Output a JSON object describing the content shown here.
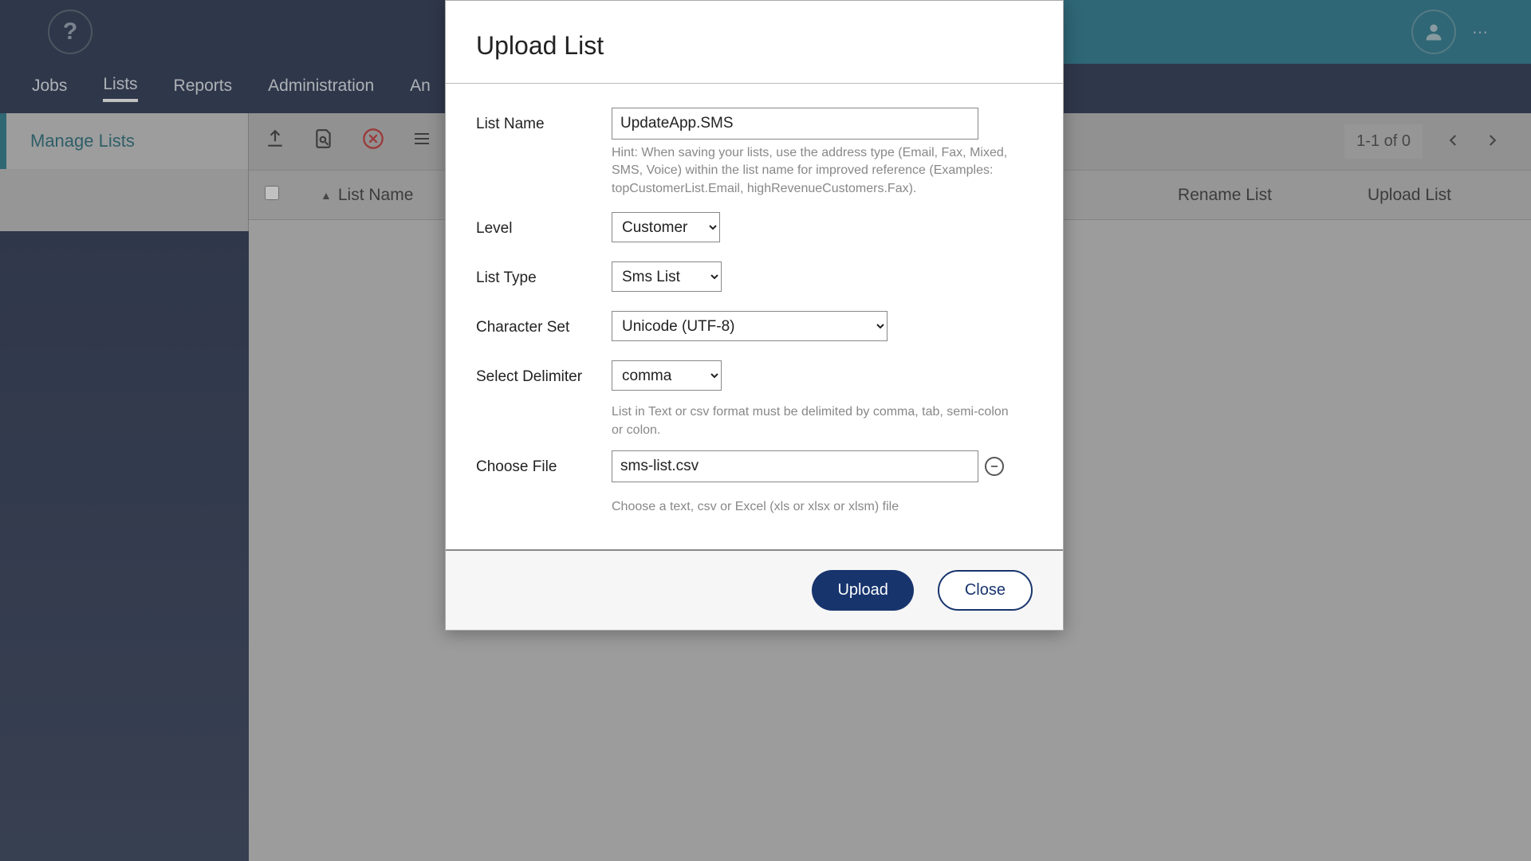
{
  "topbar": {},
  "nav": {
    "items": [
      "Jobs",
      "Lists",
      "Reports",
      "Administration",
      "An"
    ],
    "active_index": 1
  },
  "sidebar": {
    "header": "Manage Lists"
  },
  "toolbar": {
    "page_info": "1-1 of 0"
  },
  "table": {
    "col_listname": "List Name",
    "col_rename": "Rename List",
    "col_upload": "Upload List"
  },
  "modal": {
    "title": "Upload List",
    "list_name_label": "List Name",
    "list_name_value": "UpdateApp.SMS",
    "list_name_hint": "Hint: When saving your lists, use the address type (Email, Fax, Mixed, SMS, Voice) within the list name for improved reference (Examples: topCustomerList.Email, highRevenueCustomers.Fax).",
    "level_label": "Level",
    "level_value": "Customer",
    "list_type_label": "List Type",
    "list_type_value": "Sms List",
    "charset_label": "Character Set",
    "charset_value": "Unicode (UTF-8)",
    "delimiter_label": "Select Delimiter",
    "delimiter_value": "comma",
    "delimiter_hint": "List in Text or csv format must be delimited by comma, tab, semi-colon or colon.",
    "choose_file_label": "Choose File",
    "choose_file_value": "sms-list.csv",
    "choose_file_hint": "Choose a text, csv or Excel (xls or xlsx or xlsm) file",
    "upload_btn": "Upload",
    "close_btn": "Close"
  }
}
